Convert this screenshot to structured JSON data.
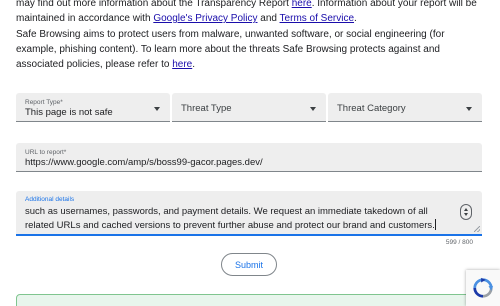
{
  "intro": {
    "part1": "may find out more information about the Transparency Report ",
    "link_here": "here",
    "part2": ". Information about your report will be maintained in accordance with ",
    "link_privacy": "Google's Privacy Policy",
    "part3": " and ",
    "link_terms": "Terms of Service",
    "part4": "."
  },
  "about": {
    "part1": "Safe Browsing aims to protect users from malware, unwanted software, or social engineering (for example, phishing content). To learn more about the threats Safe Browsing protects against and associated policies, please refer to ",
    "link_here": "here",
    "part2": "."
  },
  "form": {
    "report_type": {
      "label": "Report Type*",
      "value": "This page is not safe"
    },
    "threat_type": {
      "placeholder": "Threat Type"
    },
    "threat_category": {
      "placeholder": "Threat Category"
    },
    "url": {
      "label": "URL to report*",
      "value": "https://www.google.com/amp/s/boss99-gacor.pages.dev/"
    },
    "details": {
      "label": "Additional details",
      "value": "such as usernames, passwords, and payment details. We request an immediate takedown of all related URLs and cached versions to prevent further abuse and protect our brand and customers."
    },
    "counter": "599 / 800",
    "submit_label": "Submit"
  },
  "colors": {
    "accent": "#1a73e8",
    "link": "#1a0dab",
    "field_bg": "#eeeeee",
    "success_border": "#7fc58f"
  },
  "icons": {
    "select_caret": "chevron-down-icon",
    "spinner": "number-spinner-icon",
    "recaptcha": "recaptcha-icon"
  }
}
